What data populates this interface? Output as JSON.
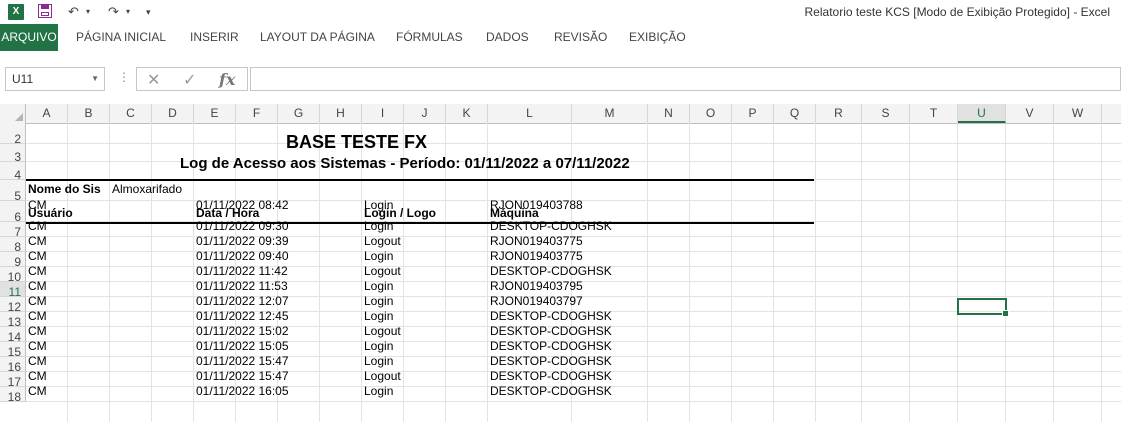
{
  "window": {
    "title": "Relatorio teste KCS  [Modo de Exibição Protegido] - Excel"
  },
  "qat": {
    "app_icon": "X",
    "undo_glyph": "↶",
    "redo_glyph": "↷",
    "more_glyph": "▾"
  },
  "ribbon": {
    "tabs": [
      "ARQUIVO",
      "PÁGINA INICIAL",
      "INSERIR",
      "LAYOUT DA PÁGINA",
      "FÓRMULAS",
      "DADOS",
      "REVISÃO",
      "EXIBIÇÃO"
    ]
  },
  "formula_bar": {
    "name_box": "U11",
    "cancel_glyph": "✕",
    "enter_glyph": "✓",
    "fx_glyph": "fx",
    "value": ""
  },
  "columns": [
    "A",
    "B",
    "C",
    "D",
    "E",
    "F",
    "G",
    "H",
    "I",
    "J",
    "K",
    "L",
    "M",
    "N",
    "O",
    "P",
    "Q",
    "R",
    "S",
    "T",
    "U",
    "V",
    "W"
  ],
  "active": {
    "column": "U",
    "row": "11"
  },
  "rows": [
    "2",
    "3",
    "4",
    "5",
    "6",
    "7",
    "8",
    "9",
    "10",
    "11",
    "12",
    "13",
    "14",
    "15",
    "16",
    "17",
    "18"
  ],
  "report": {
    "title": "BASE TESTE FX",
    "subtitle": "Log de Acesso aos Sistemas - Período: 01/11/2022 a 07/11/2022",
    "system_label": "Nome do Sis",
    "system_value": "Almoxarifado",
    "headers": {
      "user": "Usuário",
      "datetime": "Data / Hora",
      "login": "Login / Logo",
      "machine": "Máquina"
    },
    "records": [
      {
        "user": "CM",
        "datetime": "01/11/2022 08:42",
        "login": "Login",
        "machine": "RJON019403788"
      },
      {
        "user": "CM",
        "datetime": "01/11/2022 09:30",
        "login": "Login",
        "machine": "DESKTOP-CDOGHSK"
      },
      {
        "user": "CM",
        "datetime": "01/11/2022 09:39",
        "login": "Logout",
        "machine": "RJON019403775"
      },
      {
        "user": "CM",
        "datetime": "01/11/2022 09:40",
        "login": "Login",
        "machine": "RJON019403775"
      },
      {
        "user": "CM",
        "datetime": "01/11/2022 11:42",
        "login": "Logout",
        "machine": "DESKTOP-CDOGHSK"
      },
      {
        "user": "CM",
        "datetime": "01/11/2022 11:53",
        "login": "Login",
        "machine": "RJON019403795"
      },
      {
        "user": "CM",
        "datetime": "01/11/2022 12:07",
        "login": "Login",
        "machine": "RJON019403797"
      },
      {
        "user": "CM",
        "datetime": "01/11/2022 12:45",
        "login": "Login",
        "machine": "DESKTOP-CDOGHSK"
      },
      {
        "user": "CM",
        "datetime": "01/11/2022 15:02",
        "login": "Logout",
        "machine": "DESKTOP-CDOGHSK"
      },
      {
        "user": "CM",
        "datetime": "01/11/2022 15:05",
        "login": "Login",
        "machine": "DESKTOP-CDOGHSK"
      },
      {
        "user": "CM",
        "datetime": "01/11/2022 15:47",
        "login": "Login",
        "machine": "DESKTOP-CDOGHSK"
      },
      {
        "user": "CM",
        "datetime": "01/11/2022 15:47",
        "login": "Logout",
        "machine": "DESKTOP-CDOGHSK"
      },
      {
        "user": "CM",
        "datetime": "01/11/2022 16:05",
        "login": "Login",
        "machine": "DESKTOP-CDOGHSK"
      }
    ]
  }
}
